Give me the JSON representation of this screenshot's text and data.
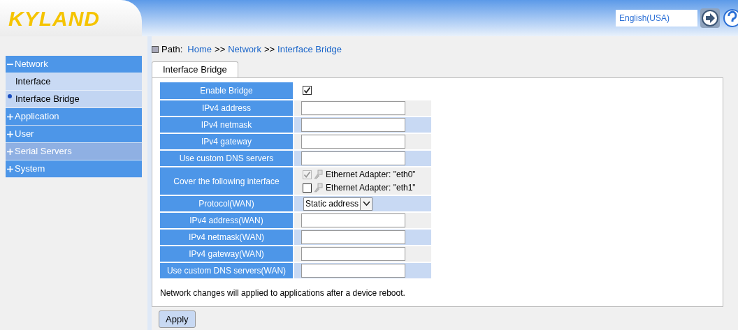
{
  "header": {
    "logo": "KYLAND",
    "language": "English(USA)"
  },
  "sidebar": {
    "items": [
      {
        "kind": "group",
        "label": "Network",
        "expanded": true,
        "hovered": false,
        "children": [
          {
            "label": "Interface",
            "selected": false
          },
          {
            "label": "Interface Bridge",
            "selected": true
          }
        ]
      },
      {
        "kind": "group",
        "label": "Application",
        "expanded": false,
        "hovered": false
      },
      {
        "kind": "group",
        "label": "User",
        "expanded": false,
        "hovered": false
      },
      {
        "kind": "group",
        "label": "Serial Servers",
        "expanded": false,
        "hovered": true
      },
      {
        "kind": "group",
        "label": "System",
        "expanded": false,
        "hovered": false
      }
    ]
  },
  "path": {
    "label": "Path:",
    "crumbs": [
      "Home",
      "Network",
      "Interface Bridge"
    ],
    "separator": ">>"
  },
  "tabs": [
    {
      "label": "Interface Bridge",
      "selected": true
    }
  ],
  "form": {
    "rows": [
      {
        "kind": "checkbox",
        "label": "Enable Bridge",
        "checked": true
      },
      {
        "kind": "input",
        "label": "IPv4 address"
      },
      {
        "kind": "input",
        "label": "IPv4 netmask"
      },
      {
        "kind": "input",
        "label": "IPv4 gateway"
      },
      {
        "kind": "input",
        "label": "Use custom DNS servers"
      },
      {
        "kind": "interfaces",
        "label": "Cover the following interface",
        "options": [
          {
            "label": "Ethernet Adapter: \"eth0\"",
            "checked": true,
            "disabled": true
          },
          {
            "label": "Ethernet Adapter: \"eth1\"",
            "checked": false,
            "disabled": false
          }
        ]
      },
      {
        "kind": "select",
        "label": "Protocol(WAN)",
        "value": "Static address"
      },
      {
        "kind": "input",
        "label": "IPv4 address(WAN)"
      },
      {
        "kind": "input",
        "label": "IPv4 netmask(WAN)"
      },
      {
        "kind": "input",
        "label": "IPv4 gateway(WAN)"
      },
      {
        "kind": "input",
        "label": "Use custom DNS servers(WAN)"
      }
    ],
    "note": "Network changes will applied to applications after a device reboot."
  },
  "buttons": [
    "Apply"
  ]
}
